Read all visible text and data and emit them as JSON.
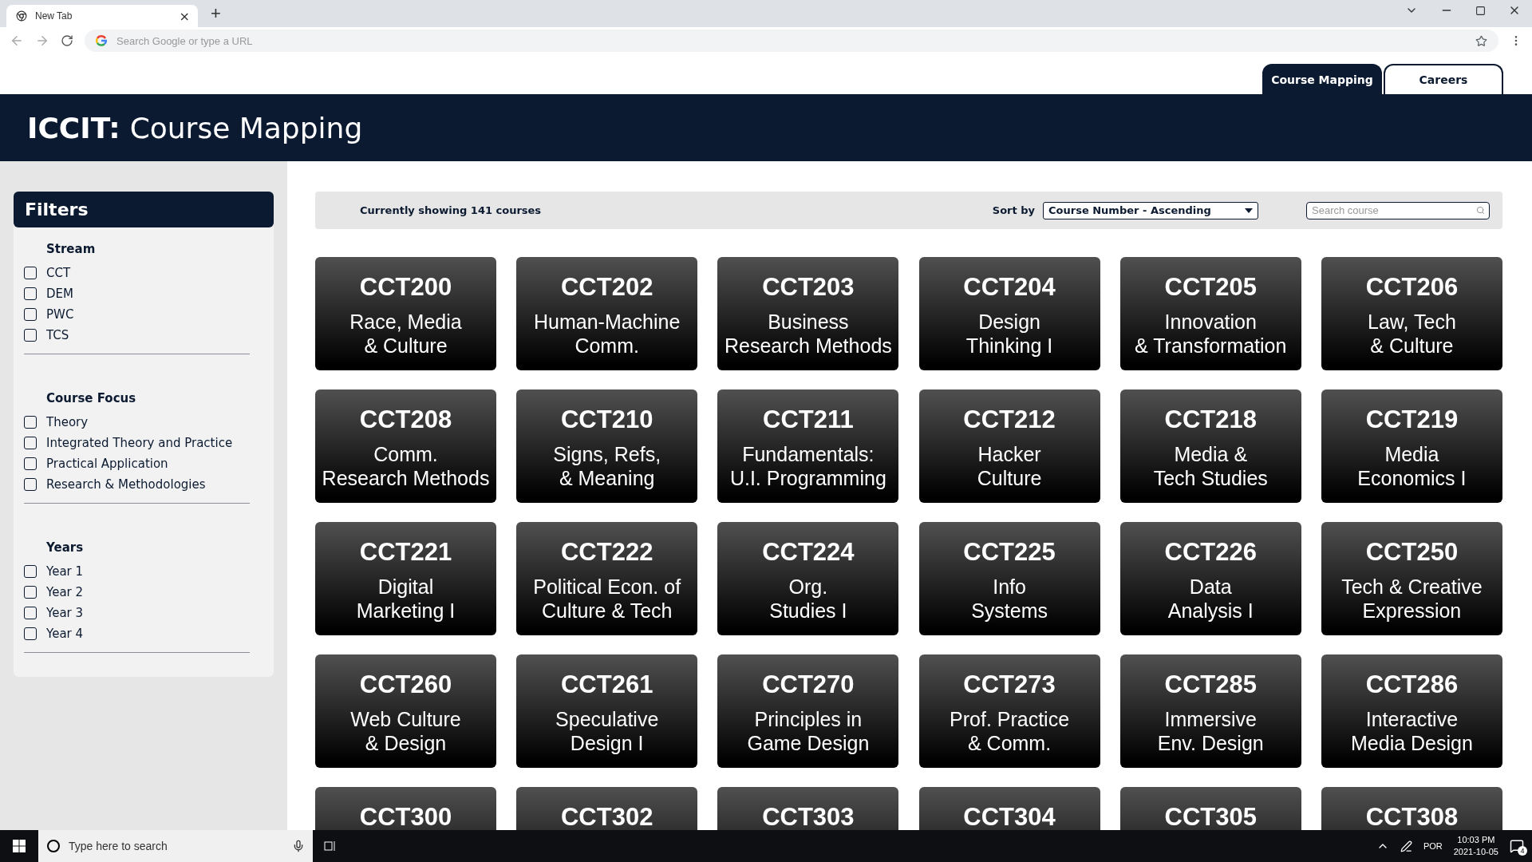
{
  "browser": {
    "tab": {
      "title": "New Tab",
      "close": "×"
    },
    "new_tab": "+",
    "address_placeholder": "Search Google or type a URL"
  },
  "site_tabs": [
    {
      "label": "Course Mapping",
      "selected": true
    },
    {
      "label": "Careers",
      "selected": false
    }
  ],
  "header": {
    "brand": "ICCIT:",
    "title": "Course Mapping"
  },
  "filters": {
    "title": "Filters",
    "groups": [
      {
        "heading": "Stream",
        "options": [
          {
            "label": "CCT",
            "checked": false
          },
          {
            "label": "DEM",
            "checked": false
          },
          {
            "label": "PWC",
            "checked": false
          },
          {
            "label": "TCS",
            "checked": false
          }
        ]
      },
      {
        "heading": "Course Focus",
        "options": [
          {
            "label": "Theory",
            "checked": false
          },
          {
            "label": "Integrated Theory and Practice",
            "checked": false
          },
          {
            "label": "Practical Application",
            "checked": false
          },
          {
            "label": "Research & Methodologies",
            "checked": false
          }
        ]
      },
      {
        "heading": "Years",
        "options": [
          {
            "label": "Year 1",
            "checked": false
          },
          {
            "label": "Year 2",
            "checked": false
          },
          {
            "label": "Year 3",
            "checked": false
          },
          {
            "label": "Year 4",
            "checked": false
          }
        ]
      }
    ]
  },
  "toolbar": {
    "count_text": "Currently showing 141 courses",
    "sort_label": "Sort by",
    "sort_value": "Course Number - Ascending",
    "search_placeholder": "Search course"
  },
  "courses": [
    {
      "code": "CCT200",
      "lines": [
        "Race, Media",
        "& Culture"
      ]
    },
    {
      "code": "CCT202",
      "lines": [
        "Human-Machine",
        "Comm."
      ]
    },
    {
      "code": "CCT203",
      "lines": [
        "Business",
        "Research Methods"
      ]
    },
    {
      "code": "CCT204",
      "lines": [
        "Design",
        "Thinking I"
      ]
    },
    {
      "code": "CCT205",
      "lines": [
        "Innovation",
        "& Transformation"
      ]
    },
    {
      "code": "CCT206",
      "lines": [
        "Law, Tech",
        "& Culture"
      ]
    },
    {
      "code": "CCT208",
      "lines": [
        "Comm.",
        "Research Methods"
      ]
    },
    {
      "code": "CCT210",
      "lines": [
        "Signs, Refs,",
        "& Meaning"
      ]
    },
    {
      "code": "CCT211",
      "lines": [
        "Fundamentals:",
        "U.I. Programming"
      ]
    },
    {
      "code": "CCT212",
      "lines": [
        "Hacker",
        "Culture"
      ]
    },
    {
      "code": "CCT218",
      "lines": [
        "Media &",
        "Tech Studies"
      ]
    },
    {
      "code": "CCT219",
      "lines": [
        "Media",
        "Economics I"
      ]
    },
    {
      "code": "CCT221",
      "lines": [
        "Digital",
        "Marketing I"
      ]
    },
    {
      "code": "CCT222",
      "lines": [
        "Political Econ. of",
        "Culture & Tech"
      ]
    },
    {
      "code": "CCT224",
      "lines": [
        "Org.",
        "Studies I"
      ]
    },
    {
      "code": "CCT225",
      "lines": [
        "Info",
        "Systems"
      ]
    },
    {
      "code": "CCT226",
      "lines": [
        "Data",
        "Analysis I"
      ]
    },
    {
      "code": "CCT250",
      "lines": [
        "Tech & Creative",
        "Expression"
      ]
    },
    {
      "code": "CCT260",
      "lines": [
        "Web Culture",
        "& Design"
      ]
    },
    {
      "code": "CCT261",
      "lines": [
        "Speculative",
        "Design I"
      ]
    },
    {
      "code": "CCT270",
      "lines": [
        "Principles in",
        "Game Design"
      ]
    },
    {
      "code": "CCT273",
      "lines": [
        "Prof. Practice",
        "& Comm."
      ]
    },
    {
      "code": "CCT285",
      "lines": [
        "Immersive",
        "Env. Design"
      ]
    },
    {
      "code": "CCT286",
      "lines": [
        "Interactive",
        "Media Design"
      ]
    },
    {
      "code": "CCT300"
    },
    {
      "code": "CCT302"
    },
    {
      "code": "CCT303"
    },
    {
      "code": "CCT304"
    },
    {
      "code": "CCT305"
    },
    {
      "code": "CCT308"
    }
  ],
  "taskbar": {
    "search_placeholder": "Type here to search",
    "language": "POR",
    "time": "10:03 PM",
    "date": "2021-10-05",
    "notifications": "4"
  }
}
